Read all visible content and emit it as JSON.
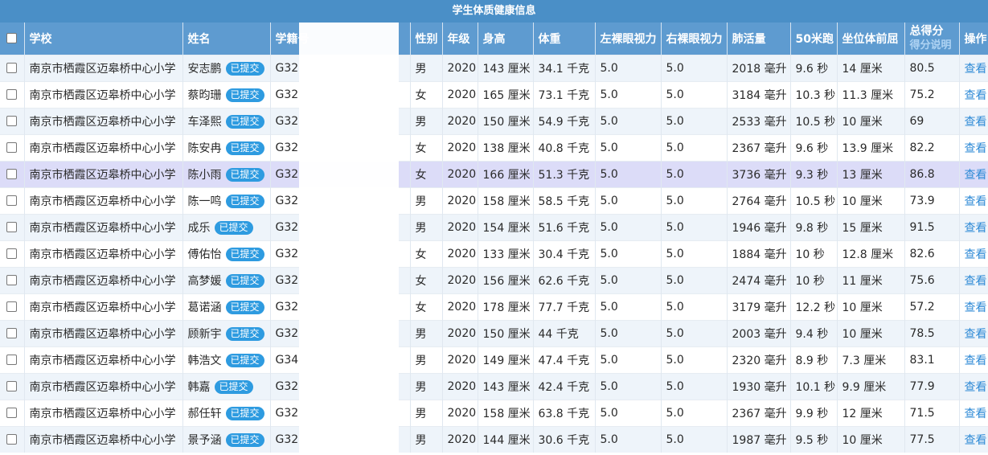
{
  "title": "学生体质健康信息",
  "headers": {
    "school": "学校",
    "name": "姓名",
    "id": "学籍号",
    "gender": "性别",
    "grade": "年级",
    "height": "身高",
    "weight": "体重",
    "left_eye": "左裸眼视力",
    "right_eye": "右裸眼视力",
    "lung": "肺活量",
    "run50": "50米跑",
    "sitreach": "坐位体前屈",
    "total": "总得分",
    "total_note": "得分说明",
    "action": "操作"
  },
  "badge_label": "已提交",
  "action_label": "查看",
  "rows": [
    {
      "school": "南京市栖霞区迈皋桥中心小学",
      "name": "安志鹏",
      "id": "G32",
      "gender": "男",
      "grade": "2020",
      "height": "143 厘米",
      "weight": "34.1 千克",
      "left": "5.0",
      "right": "5.0",
      "lung": "2018 毫升",
      "run": "9.6 秒",
      "reach": "14 厘米",
      "total": "80.5"
    },
    {
      "school": "南京市栖霞区迈皋桥中心小学",
      "name": "蔡昀珊",
      "id": "G32",
      "gender": "女",
      "grade": "2020",
      "height": "165 厘米",
      "weight": "73.1 千克",
      "left": "5.0",
      "right": "5.0",
      "lung": "3184 毫升",
      "run": "10.3 秒",
      "reach": "11.3 厘米",
      "total": "75.2"
    },
    {
      "school": "南京市栖霞区迈皋桥中心小学",
      "name": "车泽熙",
      "id": "G32",
      "gender": "男",
      "grade": "2020",
      "height": "150 厘米",
      "weight": "54.9 千克",
      "left": "5.0",
      "right": "5.0",
      "lung": "2533 毫升",
      "run": "10.5 秒",
      "reach": "10 厘米",
      "total": "69"
    },
    {
      "school": "南京市栖霞区迈皋桥中心小学",
      "name": "陈安冉",
      "id": "G32",
      "gender": "女",
      "grade": "2020",
      "height": "138 厘米",
      "weight": "40.8 千克",
      "left": "5.0",
      "right": "5.0",
      "lung": "2367 毫升",
      "run": "9.6 秒",
      "reach": "13.9 厘米",
      "total": "82.2"
    },
    {
      "school": "南京市栖霞区迈皋桥中心小学",
      "name": "陈小雨",
      "id": "G32",
      "gender": "女",
      "grade": "2020",
      "height": "166 厘米",
      "weight": "51.3 千克",
      "left": "5.0",
      "right": "5.0",
      "lung": "3736 毫升",
      "run": "9.3 秒",
      "reach": "13 厘米",
      "total": "86.8"
    },
    {
      "school": "南京市栖霞区迈皋桥中心小学",
      "name": "陈一鸣",
      "id": "G32",
      "gender": "男",
      "grade": "2020",
      "height": "158 厘米",
      "weight": "58.5 千克",
      "left": "5.0",
      "right": "5.0",
      "lung": "2764 毫升",
      "run": "10.5 秒",
      "reach": "10 厘米",
      "total": "73.9"
    },
    {
      "school": "南京市栖霞区迈皋桥中心小学",
      "name": "成乐",
      "id": "G32",
      "gender": "男",
      "grade": "2020",
      "height": "154 厘米",
      "weight": "51.6 千克",
      "left": "5.0",
      "right": "5.0",
      "lung": "1946 毫升",
      "run": "9.8 秒",
      "reach": "15 厘米",
      "total": "91.5"
    },
    {
      "school": "南京市栖霞区迈皋桥中心小学",
      "name": "傅佑怡",
      "id": "G32",
      "gender": "女",
      "grade": "2020",
      "height": "133 厘米",
      "weight": "30.4 千克",
      "left": "5.0",
      "right": "5.0",
      "lung": "1884 毫升",
      "run": "10 秒",
      "reach": "12.8 厘米",
      "total": "82.6"
    },
    {
      "school": "南京市栖霞区迈皋桥中心小学",
      "name": "高梦媛",
      "id": "G32",
      "gender": "女",
      "grade": "2020",
      "height": "156 厘米",
      "weight": "62.6 千克",
      "left": "5.0",
      "right": "5.0",
      "lung": "2474 毫升",
      "run": "10 秒",
      "reach": "11 厘米",
      "total": "75.6"
    },
    {
      "school": "南京市栖霞区迈皋桥中心小学",
      "name": "葛诺涵",
      "id": "G32",
      "gender": "女",
      "grade": "2020",
      "height": "178 厘米",
      "weight": "77.7 千克",
      "left": "5.0",
      "right": "5.0",
      "lung": "3179 毫升",
      "run": "12.2 秒",
      "reach": "10 厘米",
      "total": "57.2"
    },
    {
      "school": "南京市栖霞区迈皋桥中心小学",
      "name": "顾新宇",
      "id": "G32",
      "gender": "男",
      "grade": "2020",
      "height": "150 厘米",
      "weight": "44 千克",
      "left": "5.0",
      "right": "5.0",
      "lung": "2003 毫升",
      "run": "9.4 秒",
      "reach": "10 厘米",
      "total": "78.5"
    },
    {
      "school": "南京市栖霞区迈皋桥中心小学",
      "name": "韩浩文",
      "id": "G34",
      "gender": "男",
      "grade": "2020",
      "height": "149 厘米",
      "weight": "47.4 千克",
      "left": "5.0",
      "right": "5.0",
      "lung": "2320 毫升",
      "run": "8.9 秒",
      "reach": "7.3 厘米",
      "total": "83.1"
    },
    {
      "school": "南京市栖霞区迈皋桥中心小学",
      "name": "韩嘉",
      "id": "G32",
      "gender": "男",
      "grade": "2020",
      "height": "143 厘米",
      "weight": "42.4 千克",
      "left": "5.0",
      "right": "5.0",
      "lung": "1930 毫升",
      "run": "10.1 秒",
      "reach": "9.9 厘米",
      "total": "77.9"
    },
    {
      "school": "南京市栖霞区迈皋桥中心小学",
      "name": "郝任轩",
      "id": "G32",
      "gender": "男",
      "grade": "2020",
      "height": "158 厘米",
      "weight": "63.8 千克",
      "left": "5.0",
      "right": "5.0",
      "lung": "2367 毫升",
      "run": "9.9 秒",
      "reach": "12 厘米",
      "total": "71.5"
    },
    {
      "school": "南京市栖霞区迈皋桥中心小学",
      "name": "景予涵",
      "id": "G32",
      "gender": "男",
      "grade": "2020",
      "height": "144 厘米",
      "weight": "30.6 千克",
      "left": "5.0",
      "right": "5.0",
      "lung": "1987 毫升",
      "run": "9.5 秒",
      "reach": "10 厘米",
      "total": "77.5"
    }
  ]
}
